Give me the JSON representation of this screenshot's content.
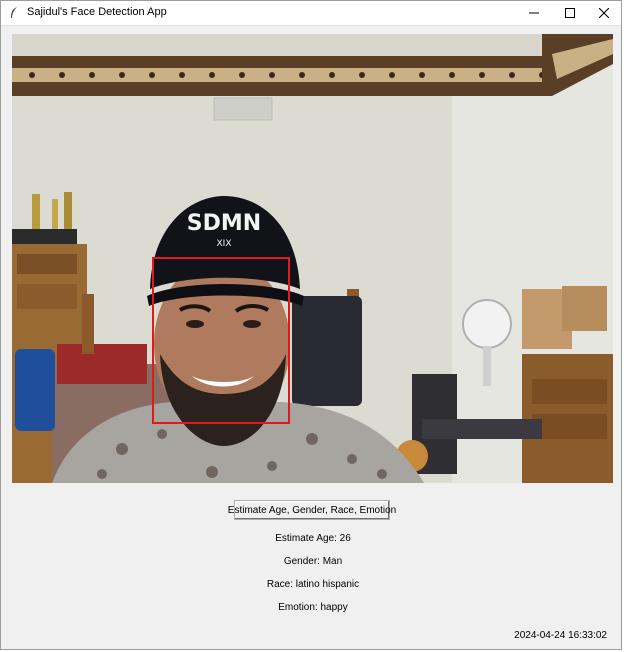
{
  "window": {
    "title": "Sajidul's Face Detection App",
    "icons": {
      "app": "feather-icon",
      "minimize": "minimize-icon",
      "maximize": "maximize-icon",
      "close": "close-icon"
    }
  },
  "main": {
    "action_button_label": "Estimate Age, Gender, Race, Emotion",
    "results": {
      "age": "Estimate Age: 26",
      "gender": "Gender: Man",
      "race": "Race: latino hispanic",
      "emotion": "Emotion: happy"
    },
    "timestamp": "2024-04-24 16:33:02"
  },
  "camera": {
    "cap_text": "SDMN",
    "cap_subtext": "XIX",
    "detection_box_color": "#e11b1b"
  }
}
